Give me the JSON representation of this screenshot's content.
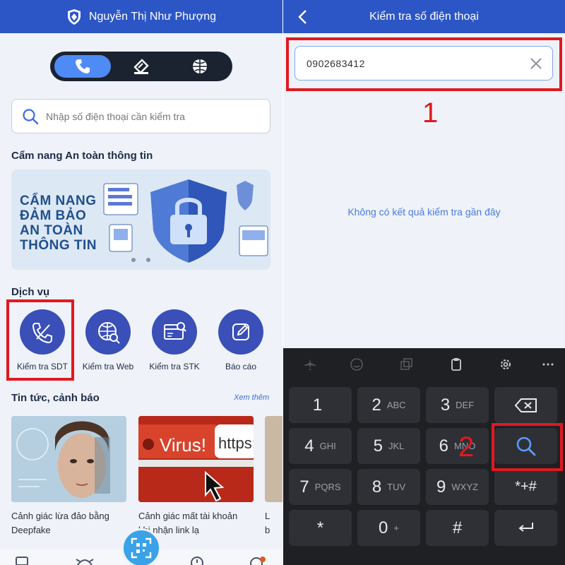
{
  "left": {
    "header": {
      "title": "Nguyễn Thị Như Phượng"
    },
    "tabs": [
      {
        "icon": "phone-icon",
        "active": true
      },
      {
        "icon": "ticket-icon",
        "active": false
      },
      {
        "icon": "globe-icon",
        "active": false
      }
    ],
    "search": {
      "placeholder": "Nhập số điện thoại cần kiểm tra"
    },
    "handbook": {
      "title": "Cẩm nang An toàn thông tin",
      "banner_lines": [
        "CẨM NANG",
        "ĐẢM BẢO",
        "AN TOÀN",
        "THÔNG TIN"
      ]
    },
    "services": {
      "title": "Dịch vụ",
      "items": [
        {
          "label": "Kiểm tra SDT",
          "icon": "phone-check-icon"
        },
        {
          "label": "Kiểm tra Web",
          "icon": "web-check-icon"
        },
        {
          "label": "Kiểm tra STK",
          "icon": "account-check-icon"
        },
        {
          "label": "Báo cáo",
          "icon": "report-edit-icon"
        }
      ]
    },
    "news": {
      "title": "Tin tức, cảnh báo",
      "see_more": "Xem thêm",
      "items": [
        {
          "caption_1": "Cảnh giác lừa đảo bằng",
          "caption_2": "Deepfake"
        },
        {
          "caption_1": "Cảnh giác mất tài khoản",
          "caption_2": "khi nhận link lạ",
          "image_text_1": "Virus!",
          "image_text_2": "https:/"
        },
        {
          "caption_1": "L",
          "caption_2": "b"
        }
      ]
    }
  },
  "right": {
    "header": {
      "title": "Kiểm tra số điện thoại"
    },
    "phone_input": {
      "value": "0902683412"
    },
    "empty_message": "Không có kết quả kiểm tra gần đây",
    "annotations": {
      "step1": "1",
      "step2": "2"
    },
    "keyboard": {
      "keys": [
        {
          "num": "1",
          "sub": ""
        },
        {
          "num": "2",
          "sub": "ABC"
        },
        {
          "num": "3",
          "sub": "DEF"
        },
        {
          "num": "4",
          "sub": "GHI"
        },
        {
          "num": "5",
          "sub": "JKL"
        },
        {
          "num": "6",
          "sub": "MNO"
        },
        {
          "num": "7",
          "sub": "PQRS"
        },
        {
          "num": "8",
          "sub": "TUV"
        },
        {
          "num": "9",
          "sub": "WXYZ"
        },
        {
          "num": "*",
          "sub": ""
        },
        {
          "num": "0",
          "sub": "+"
        },
        {
          "num": "#",
          "sub": ""
        }
      ],
      "symbols_key": "*+#"
    }
  },
  "colors": {
    "header": "#2c56c5",
    "highlight": "#e0191f",
    "service_circle": "#3a4fb7",
    "link": "#4a7be0"
  }
}
